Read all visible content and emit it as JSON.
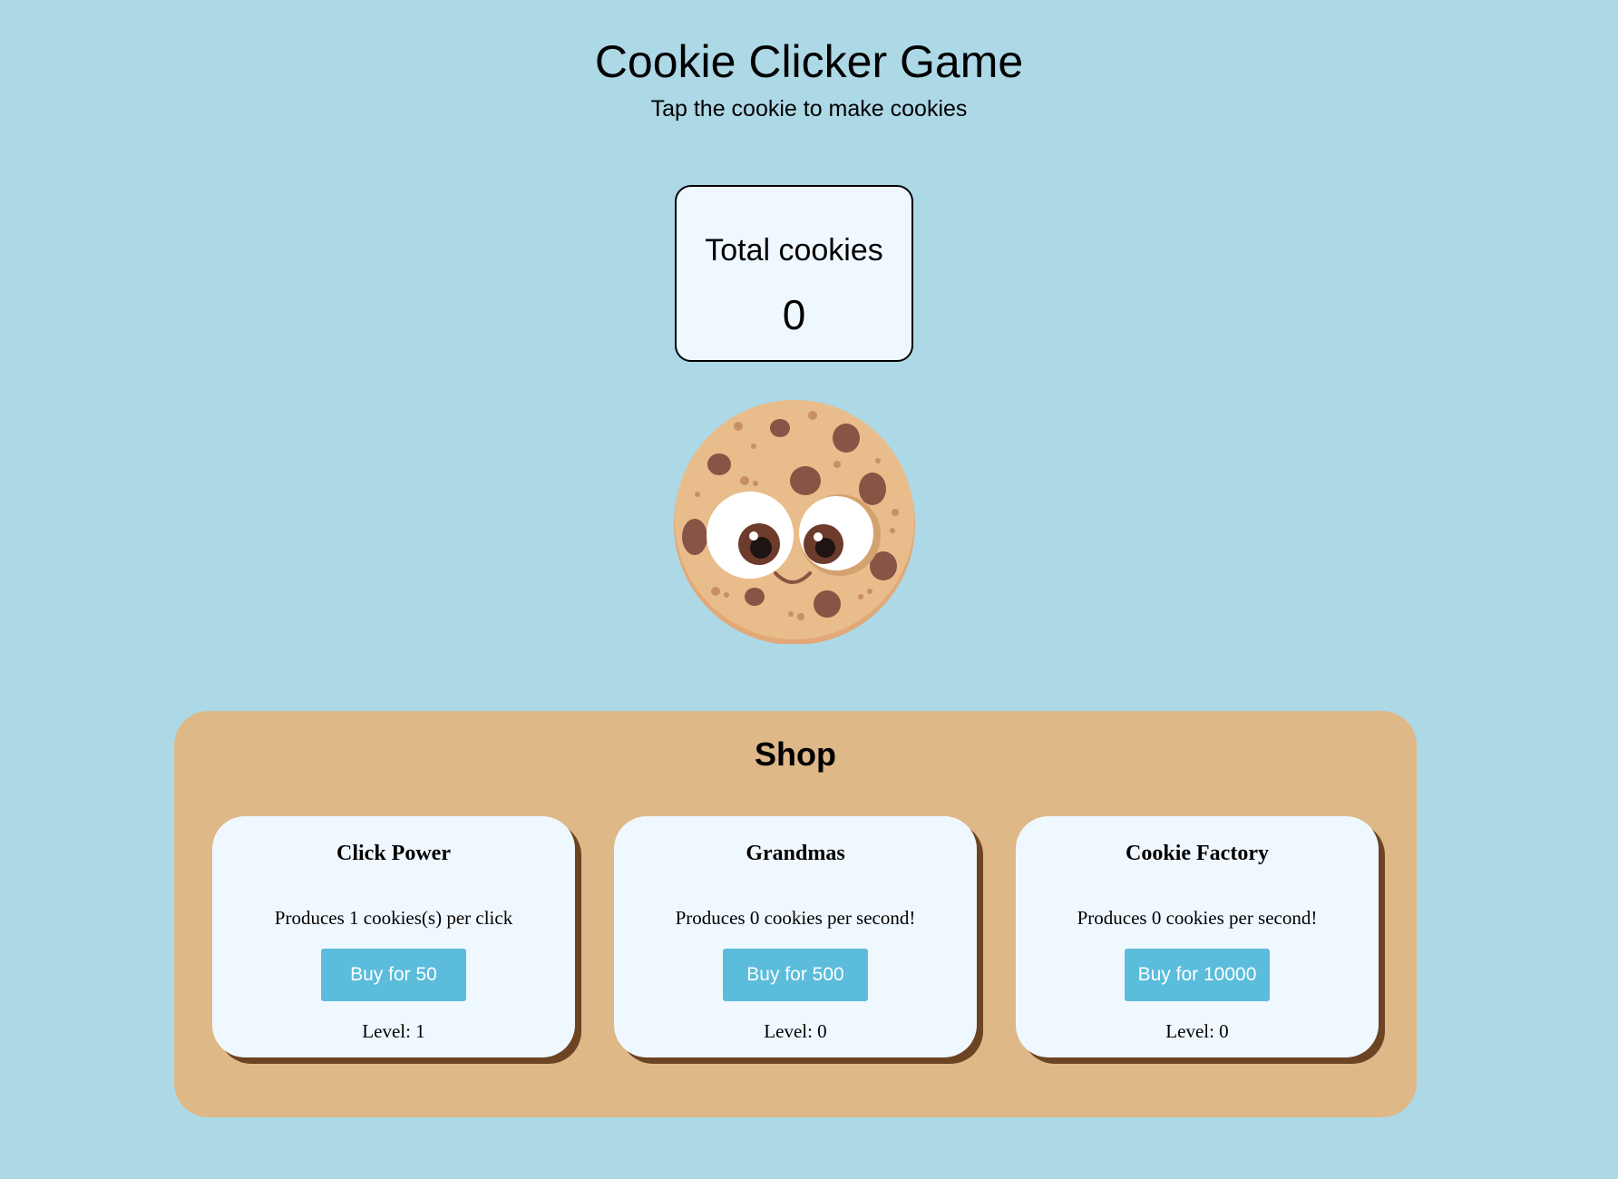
{
  "header": {
    "title": "Cookie Clicker Game",
    "subtitle": "Tap the cookie to make cookies"
  },
  "counter": {
    "label": "Total cookies",
    "value": "0"
  },
  "shop": {
    "title": "Shop",
    "items": [
      {
        "name": "Click Power",
        "description": "Produces 1 cookies(s) per click",
        "button_label": "Buy for 50",
        "level": "Level: 1"
      },
      {
        "name": "Grandmas",
        "description": "Produces 0 cookies per second!",
        "button_label": "Buy for 500",
        "level": "Level: 0"
      },
      {
        "name": "Cookie Factory",
        "description": "Produces 0 cookies per second!",
        "button_label": "Buy for 10000",
        "level": "Level: 0"
      }
    ]
  },
  "colors": {
    "background": "#add8e6",
    "panel": "#f0f8ff",
    "shop": "#deb887",
    "card_shadow": "#6b4423",
    "button": "#5bbcdb"
  }
}
